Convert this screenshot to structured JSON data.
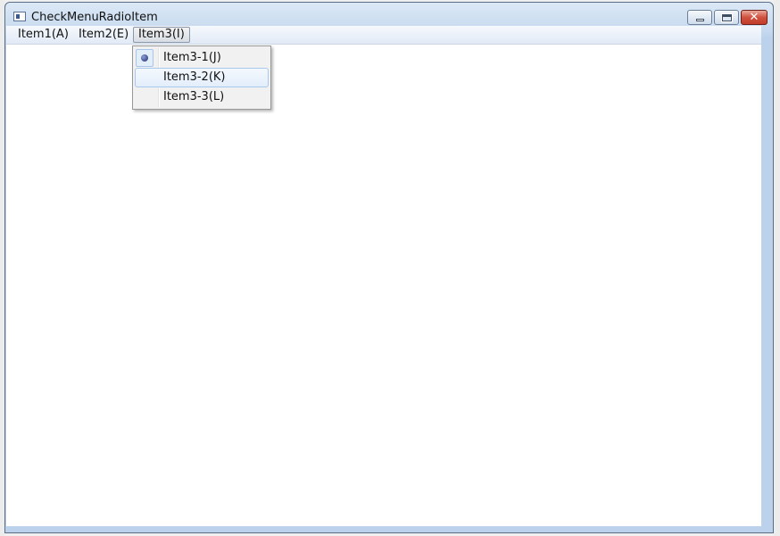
{
  "window": {
    "title": "CheckMenuRadioItem",
    "icon": "application-window-icon",
    "caption_buttons": {
      "minimize": "minimize-icon",
      "maximize": "maximize-icon",
      "close": "close-icon"
    }
  },
  "menubar": {
    "items": [
      {
        "label": "Item1(A)"
      },
      {
        "label": "Item2(E)"
      },
      {
        "label": "Item3(I)",
        "active": true
      }
    ]
  },
  "dropdown": {
    "items": [
      {
        "label": "Item3-1(J)",
        "checked": true,
        "mark": "radio-bullet-icon"
      },
      {
        "label": "Item3-2(K)",
        "highlighted": true
      },
      {
        "label": "Item3-3(L)"
      }
    ]
  },
  "colors": {
    "close_button": "#d0513e",
    "highlight": "#e3eefb",
    "client_background": "#ffffff"
  }
}
